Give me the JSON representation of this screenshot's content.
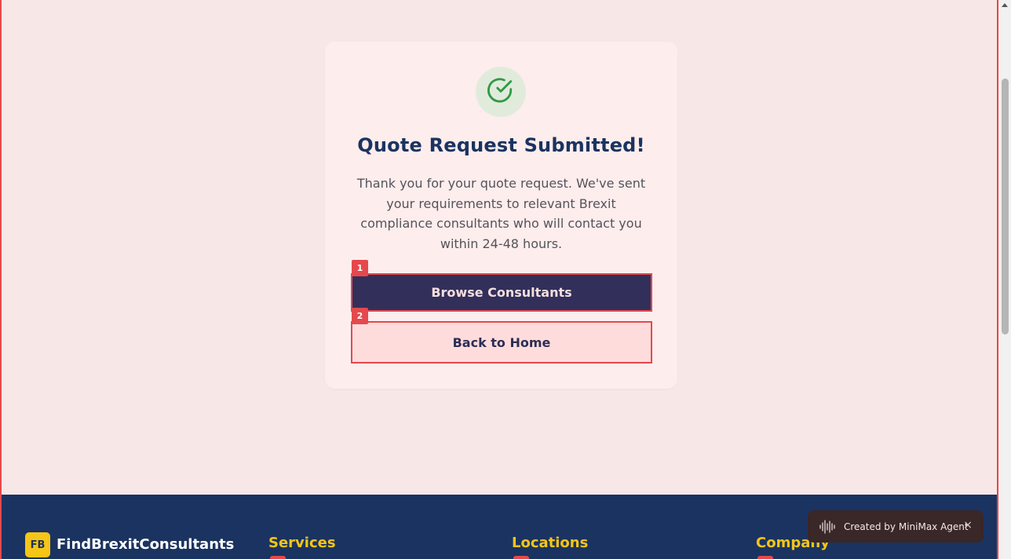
{
  "success": {
    "icon": "check-circle-icon",
    "title": "Quote Request Submitted!",
    "message_lines": [
      "Thank you for your quote request. We've sent",
      "your requirements to relevant Brexit",
      "compliance consultants who will contact you",
      "within 24-48 hours."
    ]
  },
  "buttons": {
    "browse_label": "Browse Consultants",
    "browse_marker": "1",
    "home_label": "Back to Home",
    "home_marker": "2"
  },
  "footer": {
    "logo_badge": "FB",
    "brand": "FindBrexitConsultants",
    "columns": [
      "Services",
      "Locations",
      "Company"
    ]
  },
  "toast": {
    "icon": "waveform-icon",
    "text": "Created by MiniMax Agent",
    "close": "×"
  },
  "colors": {
    "accent_red": "#e5484d",
    "navy": "#1b3360",
    "primary_button": "#32305a",
    "gold": "#f5c518",
    "success_green": "#2f9a45"
  }
}
